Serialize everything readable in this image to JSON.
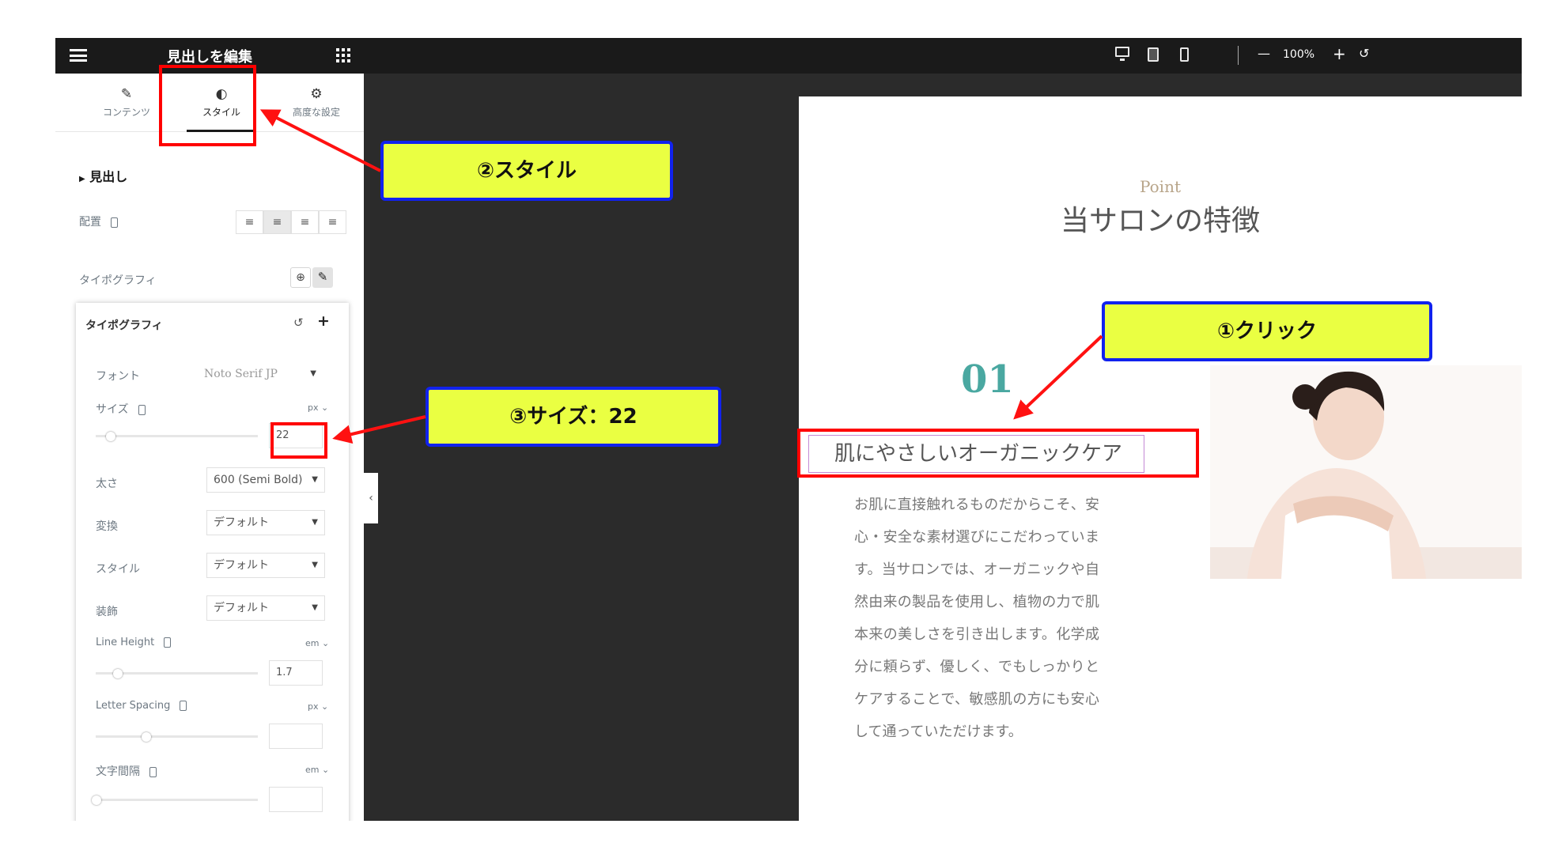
{
  "panel": {
    "title": "見出しを編集",
    "tabs": [
      {
        "label": "コンテンツ",
        "icon": "pencil-icon"
      },
      {
        "label": "スタイル",
        "icon": "contrast-icon"
      },
      {
        "label": "高度な設定",
        "icon": "gear-icon"
      }
    ],
    "section_label": "見出し",
    "alignment_label": "配置",
    "typography_label": "タイポグラフィ",
    "typography_popup": {
      "title": "タイポグラフィ",
      "font_label": "フォント",
      "font_value": "Noto Serif JP",
      "size_label": "サイズ",
      "size_unit": "px",
      "size_value": "22",
      "weight_label": "太さ",
      "weight_value": "600 (Semi Bold)",
      "transform_label": "変換",
      "transform_value": "デフォルト",
      "style_label": "スタイル",
      "style_value": "デフォルト",
      "decoration_label": "装飾",
      "decoration_value": "デフォルト",
      "line_height_label": "Line Height",
      "line_height_unit": "em",
      "line_height_value": "1.7",
      "letter_spacing_label": "Letter Spacing",
      "letter_spacing_unit": "px",
      "word_spacing_label": "文字間隔",
      "word_spacing_unit": "em"
    }
  },
  "toolbar": {
    "zoom": "100%",
    "minus": "—",
    "plus": "+",
    "undo": "↺"
  },
  "preview": {
    "eyebrow": "Point",
    "section_title": "当サロンの特徴",
    "number": "01",
    "heading": "肌にやさしいオーガニックケア",
    "body": "お肌に直接触れるものだからこそ、安心・安全な素材選びにこだわっています。当サロンでは、オーガニックや自然由来の製品を使用し、植物の力で肌本来の美しさを引き出します。化学成分に頼らず、優しく、でもしっかりとケアすることで、敏感肌の方にも安心して通っていただけます。"
  },
  "annotations": {
    "step1": "①クリック",
    "step2": "②スタイル",
    "step3": "③サイズ：22"
  },
  "colors": {
    "callout_fill": "#eaff42",
    "callout_border": "#1122ee",
    "highlight": "#ff0000",
    "accent_teal": "#4aa8a1"
  }
}
